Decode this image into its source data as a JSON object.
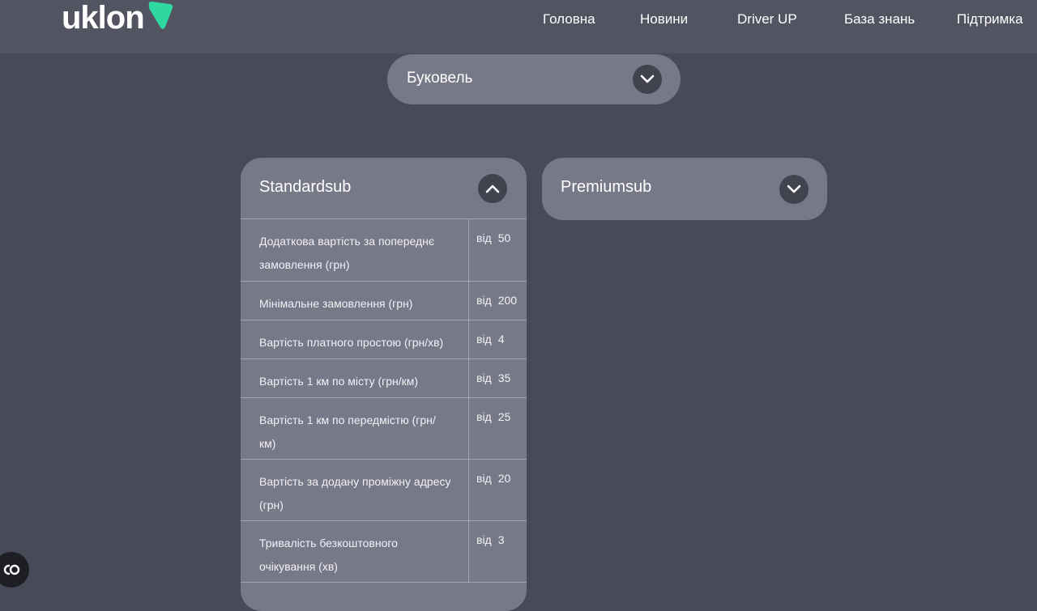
{
  "header": {
    "logo_text": "uklon",
    "nav": [
      "Головна",
      "Новини",
      "Driver UP",
      "База знань",
      "Підтримка"
    ]
  },
  "city_select": {
    "value": "Буковель",
    "icon": "chevron-down-icon"
  },
  "tariffs": {
    "standard": {
      "title": "Standardsub",
      "expanded": true,
      "rows": [
        {
          "label": "Додаткова вартість за попереднє замовлення (грн)",
          "prefix": "від",
          "value": "50"
        },
        {
          "label": "Мінімальне замовлення (грн)",
          "prefix": "від",
          "value": "200"
        },
        {
          "label": "Вартість платного простою (грн/хв)",
          "prefix": "від",
          "value": "4"
        },
        {
          "label": "Вартість 1 км по місту (грн/км)",
          "prefix": "від",
          "value": "35"
        },
        {
          "label": "Вартість 1 км по передмістю (грн/км)",
          "prefix": "від",
          "value": "25"
        },
        {
          "label": "Вартість за додану проміжну адресу (грн)",
          "prefix": "від",
          "value": "20"
        },
        {
          "label": "Тривалість безкоштовного очікування (хв)",
          "prefix": "від",
          "value": "3"
        }
      ]
    },
    "premium": {
      "title": "Premiumsub",
      "expanded": false
    }
  },
  "colors": {
    "background": "#484a57",
    "header": "#525462",
    "card": "#777888",
    "accent": "#2fd8a0"
  }
}
